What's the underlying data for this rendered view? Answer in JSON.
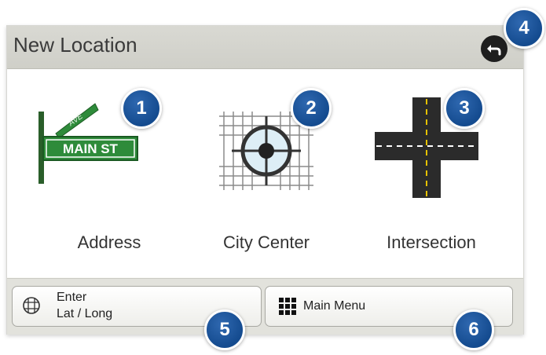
{
  "header": {
    "title": "New Location"
  },
  "options": [
    {
      "label": "Address",
      "sign_text": "MAIN ST",
      "sign_small_text": "AVE"
    },
    {
      "label": "City Center"
    },
    {
      "label": "Intersection"
    }
  ],
  "bottom": {
    "enter_latlong_line1": "Enter",
    "enter_latlong_line2": "Lat / Long",
    "main_menu_label": "Main Menu"
  },
  "callouts": [
    "1",
    "2",
    "3",
    "4",
    "5",
    "6"
  ],
  "icons": {
    "back": "back-arrow-icon",
    "address": "street-sign-icon",
    "city_center": "target-grid-icon",
    "intersection": "road-intersection-icon",
    "latlong": "globe-grid-icon",
    "main_menu": "grid-menu-icon"
  },
  "colors": {
    "title_bar": "#d4d4cd",
    "callout_badge": "#1a5296",
    "sign_green": "#2e8b3a",
    "road": "#2b2b2b"
  }
}
